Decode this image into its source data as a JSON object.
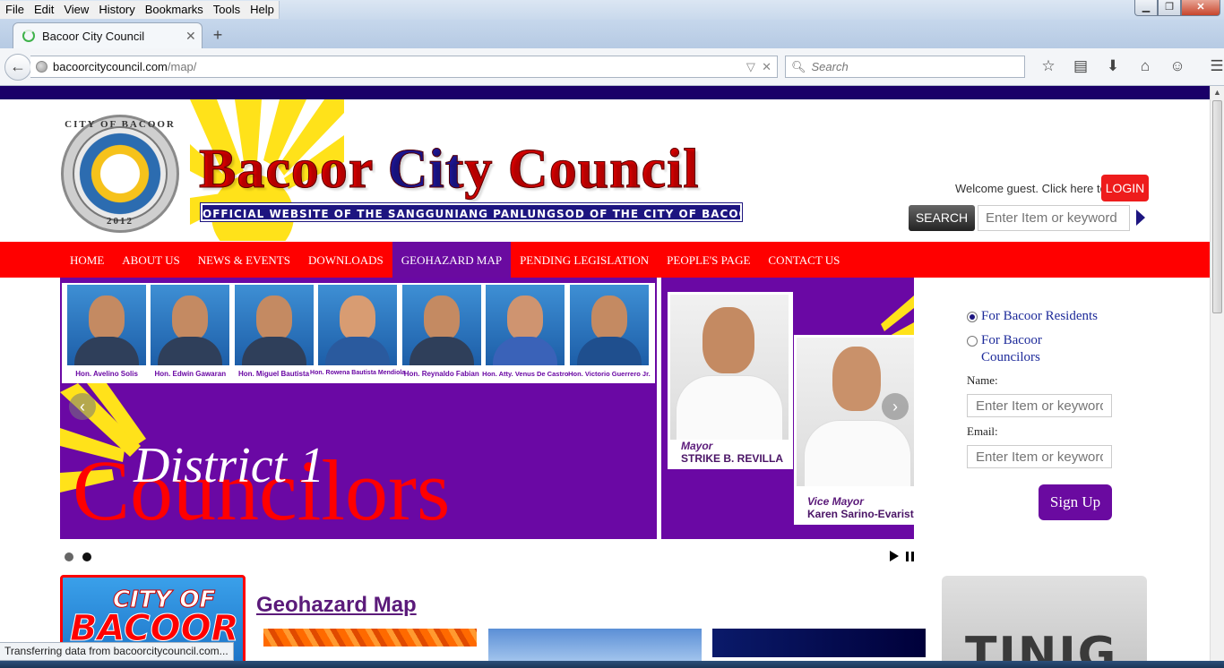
{
  "browser": {
    "menu": [
      "File",
      "Edit",
      "View",
      "History",
      "Bookmarks",
      "Tools",
      "Help"
    ],
    "tab_title": "Bacoor City Council",
    "url_host": "bacoorcitycouncil.com",
    "url_path": "/map/",
    "search_placeholder": "Search",
    "status_text": "Transferring data from bacoorcitycouncil.com..."
  },
  "header": {
    "seal_top": "CITY OF BACOOR",
    "seal_year": "2012",
    "site_title": "Bacoor City Council",
    "tagline": "OFFICIAL WEBSITE OF THE SANGGUNIANG PANLUNGSOD OF THE CITY OF BACOOR, CAVITE",
    "welcome": "Welcome guest. Click here to",
    "login_label": "LOGIN",
    "search_label": "SEARCH",
    "search_placeholder": "Enter Item or keyword"
  },
  "nav": [
    "HOME",
    "ABOUT US",
    "NEWS & EVENTS",
    "DOWNLOADS",
    "GEOHAZARD MAP",
    "PENDING LEGISLATION",
    "PEOPLE'S PAGE",
    "CONTACT US"
  ],
  "nav_active": "GEOHAZARD MAP",
  "slider": {
    "councilors": [
      "Hon. Avelino Solis",
      "Hon. Edwin Gawaran",
      "Hon. Miguel Bautista",
      "Hon. Rowena Bautista Mendiola",
      "Hon. Reynaldo Fabian",
      "Hon. Atty. Venus De Castro",
      "Hon. Victorio Guerrero Jr."
    ],
    "district_text": "District 1",
    "councilors_text": "Councilors",
    "mayor_title": "Mayor",
    "mayor_name": "STRIKE B. REVILLA",
    "vice_title": "Vice Mayor",
    "vice_name": "Karen Sarino-Evaristo",
    "prev_icon": "‹",
    "next_icon": "›",
    "slides": 2,
    "active_slide": 2
  },
  "signup_form": {
    "option_residents": "For Bacoor Residents",
    "option_councilors": "For Bacoor Councilors",
    "name_label": "Name:",
    "email_label": "Email:",
    "name_placeholder": "Enter Item or keyword",
    "email_placeholder": "Enter Item or keyword",
    "signup_label": "Sign Up"
  },
  "content": {
    "logo_line1": "CITY OF",
    "logo_line2": "BACOOR",
    "section_title": "Geohazard Map",
    "ad_text": "TINIG"
  },
  "colors": {
    "nav_red": "#ff0000",
    "purple": "#6a0aa0",
    "navy": "#1d1580"
  }
}
